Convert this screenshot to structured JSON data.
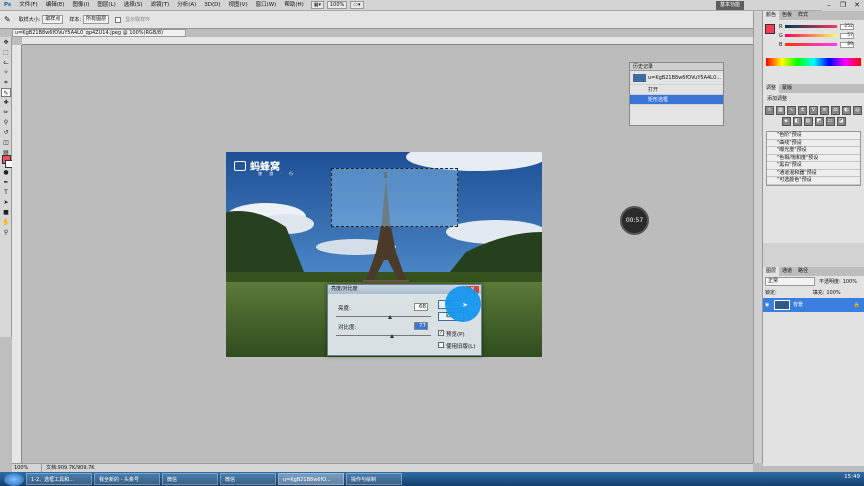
{
  "menu": {
    "items": [
      "文件(F)",
      "编辑(E)",
      "图像(I)",
      "图层(L)",
      "选择(S)",
      "滤镜(T)",
      "分析(A)",
      "3D(D)",
      "视图(V)",
      "窗口(W)",
      "帮助(H)"
    ],
    "zoom": "100%",
    "essentials": "基本功能"
  },
  "options": {
    "size_label": "取样大小:",
    "size_value": "取样点",
    "sample_label": "样本:",
    "sample_value": "所有图层",
    "checkbox_label": "显示取样环"
  },
  "doc": {
    "tab_title": "u=KgB21B8w6fOVuY5A4L0_qp4ZU14.jpeg @ 100%(RGB/8)",
    "zoom": "100%",
    "doc_size": "文档:909.7K/909.7K"
  },
  "watermark": {
    "brand": "蚂蜂窝",
    "sub": "旅 游 · 行"
  },
  "dialog": {
    "title": "亮度/对比度",
    "brightness_label": "亮度:",
    "brightness_value": "68",
    "contrast_label": "对比度:",
    "contrast_value": "77",
    "ok_label": "确定",
    "cancel_label": "取消",
    "auto_label": "自动",
    "preview_label": "预览(P)",
    "legacy_label": "使用旧版(L)",
    "preview_checked": true,
    "brightness_fraction": 0.57,
    "contrast_fraction": 0.59
  },
  "timer": "00:57",
  "history": {
    "title": "历史记录",
    "snapshot": "u=KgB21B8w6fOVuY5A4L0...",
    "items": [
      "打开",
      "矩形选框"
    ]
  },
  "color_panel": {
    "tabs": [
      "颜色",
      "色板",
      "样式"
    ],
    "r": "252",
    "g": "57",
    "b": "89",
    "fg": "#fc3959"
  },
  "adjustments": {
    "tabs": [
      "调整",
      "蒙版"
    ],
    "title": "添加调整",
    "presets": [
      "\"色阶\"预设",
      "\"曲线\"预设",
      "\"曝光度\"预设",
      "\"色相/饱和度\"预设",
      "\"黑白\"预设",
      "\"通道混和器\"预设",
      "\"可选颜色\"预设"
    ]
  },
  "layers": {
    "tabs": [
      "图层",
      "通道",
      "路径"
    ],
    "blend": "正常",
    "opacity_label": "不透明度:",
    "opacity": "100%",
    "fill_label": "填充:",
    "fill": "100%",
    "lock_label": "锁定:",
    "layer_name": "背景"
  },
  "taskbar": {
    "items": [
      "1-2、选框工具和...",
      "我全新的 - 头条号",
      "微信",
      "微信",
      "u=KgB21B8w6fO...",
      "操作与绘制"
    ],
    "time": "15:49"
  }
}
